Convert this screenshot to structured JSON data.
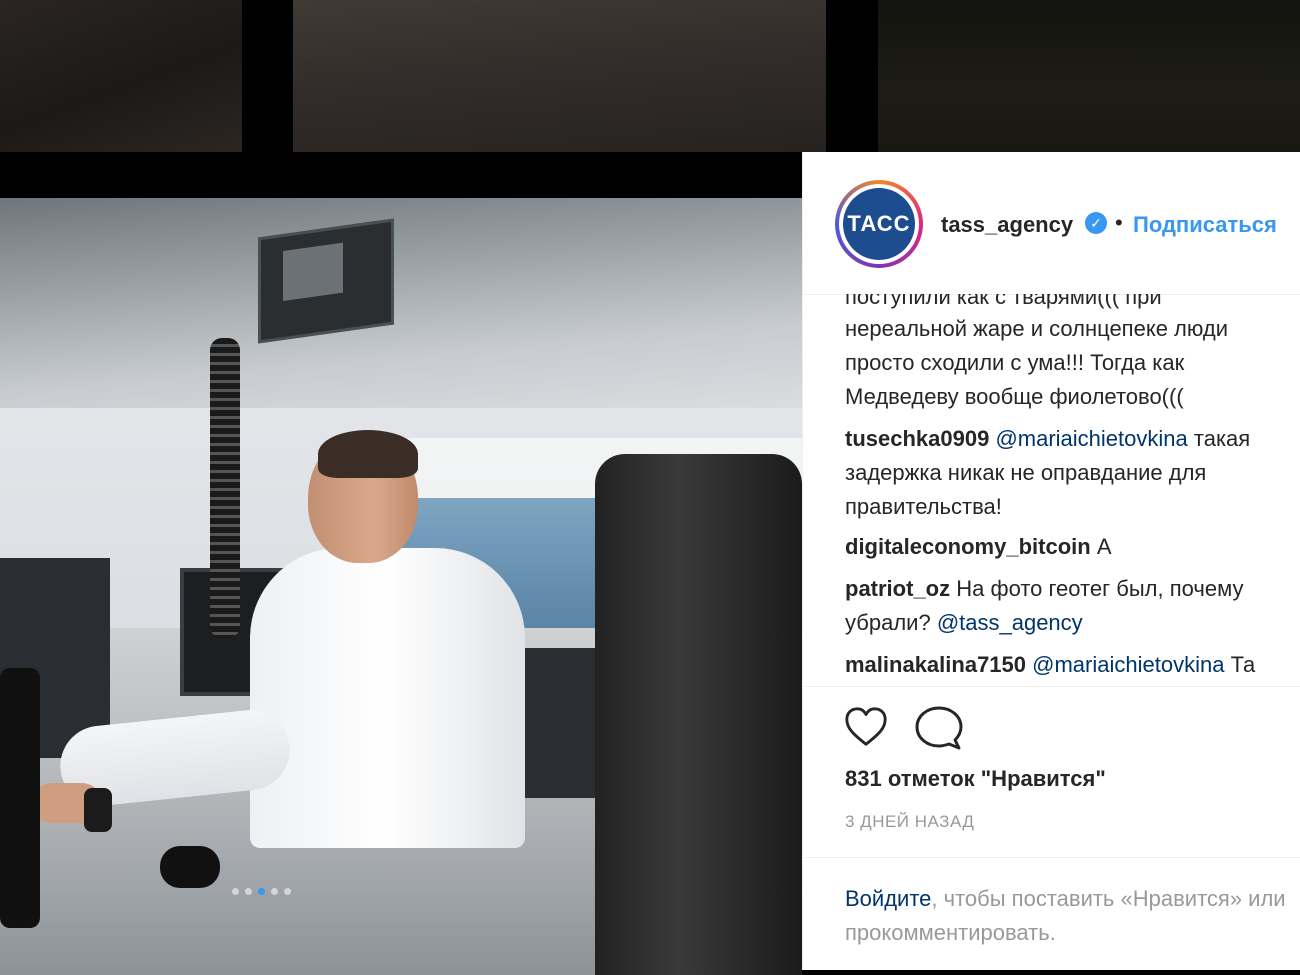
{
  "post": {
    "username": "tass_agency",
    "avatar_text": "ТАСС",
    "separator": "•",
    "follow_label": "Подписаться"
  },
  "comments": [
    {
      "user": "",
      "text": "поступили как с тварями((( при"
    },
    {
      "user": "",
      "text": "нереальной жаре и солнцепеке люди"
    },
    {
      "user": "",
      "text": "просто сходили с ума!!! Тогда как"
    },
    {
      "user": "",
      "text": "Медведеву вообще фиолетово((("
    },
    {
      "user": "tusechka0909",
      "mention": "@mariaichietovkina",
      "text": "такая"
    },
    {
      "user": "",
      "text": "задержка никак не оправдание для"
    },
    {
      "user": "",
      "text": "правительства!"
    },
    {
      "user": "digitaleconomy_bitcoin",
      "text": "А"
    },
    {
      "user": "patriot_oz",
      "text": "На фото геотег был, почему"
    },
    {
      "user": "",
      "text": "убрали?",
      "mention": "@tass_agency"
    },
    {
      "user": "malinakalina7150",
      "mention": "@mariaichietovkina",
      "text": "Та"
    }
  ],
  "actions": {
    "like_icon": "heart-icon",
    "comment_icon": "comment-bubble-icon",
    "likes_text": "831 отметок \"Нравится\"",
    "time_text": "3 ДНЕЙ НАЗАД"
  },
  "login": {
    "link": "Войдите",
    "text": ", чтобы поставить «Нравится» или прокомментировать."
  },
  "carousel": {
    "total": 5,
    "active": 2
  },
  "colors": {
    "link": "#3897f0",
    "mention": "#003569",
    "muted": "#999999",
    "text": "#262626"
  }
}
